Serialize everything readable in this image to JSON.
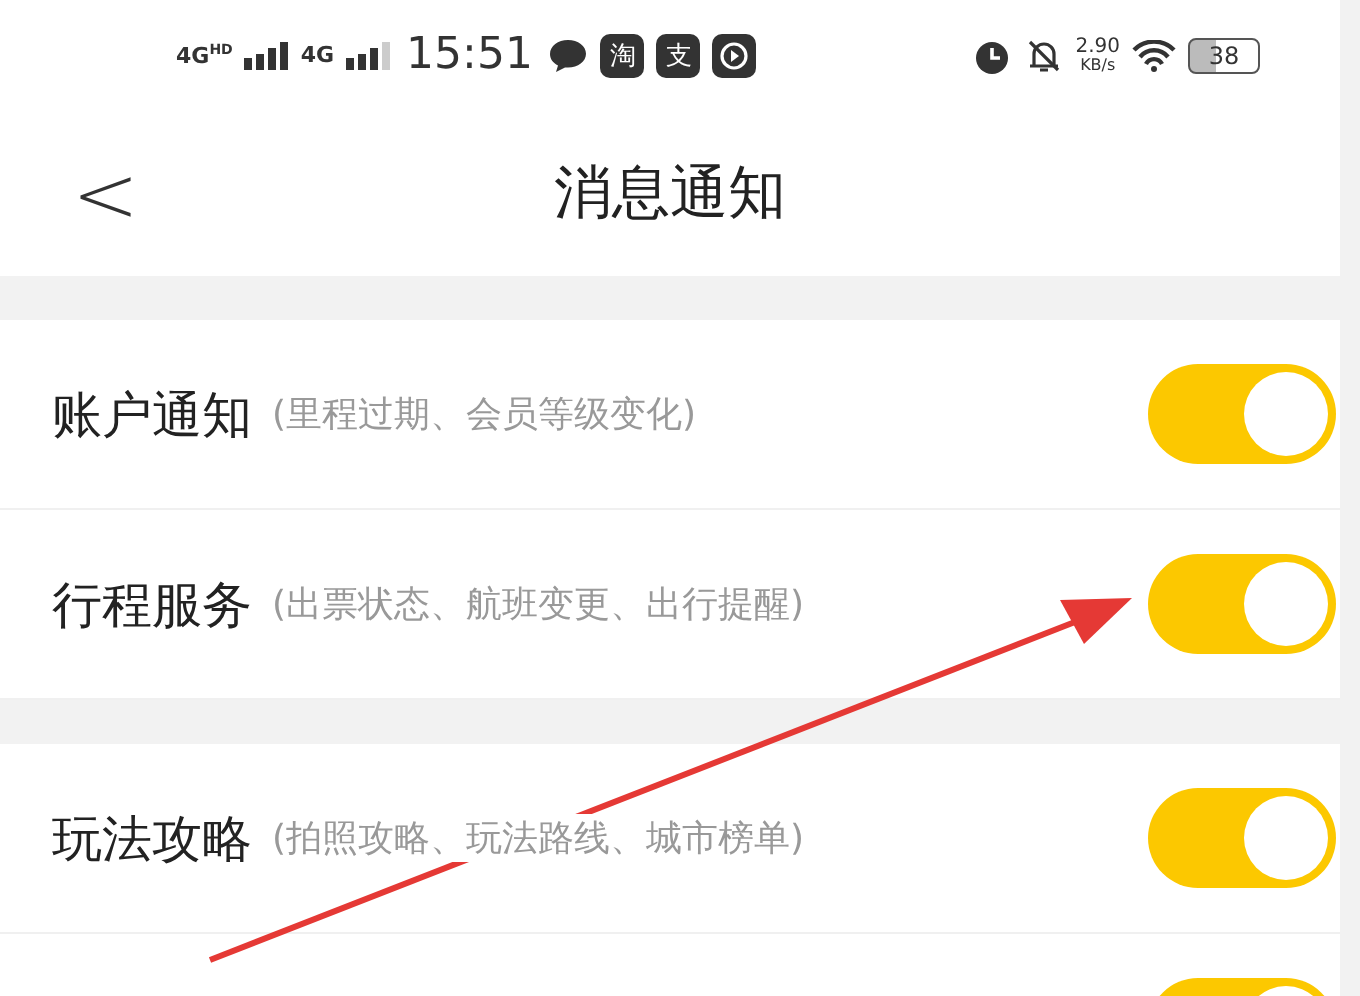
{
  "status_bar": {
    "network_1": "4G",
    "network_1_suffix": "HD",
    "network_2": "4G",
    "time": "15:51",
    "app_icons": [
      "淘",
      "支"
    ],
    "speed": "2.90",
    "speed_unit": "KB/s",
    "battery": "38"
  },
  "header": {
    "back": "<",
    "title": "消息通知"
  },
  "groups": [
    {
      "items": [
        {
          "label": "账户通知",
          "hint": "(里程过期、会员等级变化)",
          "on": true
        },
        {
          "label": "行程服务",
          "hint": "(出票状态、航班变更、出行提醒)",
          "on": true
        }
      ]
    },
    {
      "items": [
        {
          "label": "玩法攻略",
          "hint": "(拍照攻略、玩法路线、城市榜单)",
          "on": true
        },
        {
          "on": true
        }
      ]
    }
  ]
}
